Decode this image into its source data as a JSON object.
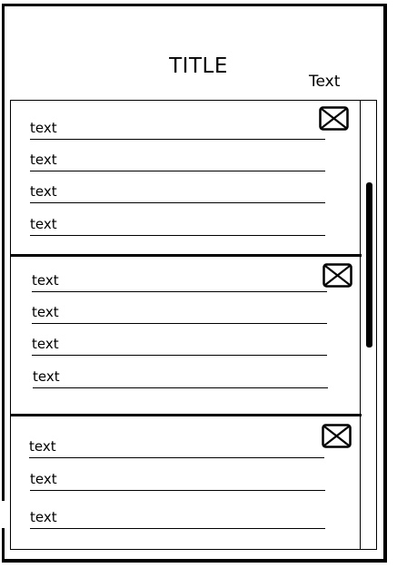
{
  "header": {
    "title": "TITLE",
    "side_text": "Text"
  },
  "cards": [
    {
      "fields": [
        {
          "label": "text"
        },
        {
          "label": "text"
        },
        {
          "label": "text"
        },
        {
          "label": "text"
        }
      ],
      "close_icon": "close-box-icon"
    },
    {
      "fields": [
        {
          "label": "text"
        },
        {
          "label": "text"
        },
        {
          "label": "text"
        },
        {
          "label": "text"
        }
      ],
      "close_icon": "close-box-icon"
    },
    {
      "fields": [
        {
          "label": "text"
        },
        {
          "label": "text"
        },
        {
          "label": "text"
        }
      ],
      "close_icon": "close-box-icon"
    }
  ],
  "colors": {
    "line": "#000000",
    "background": "#ffffff"
  }
}
